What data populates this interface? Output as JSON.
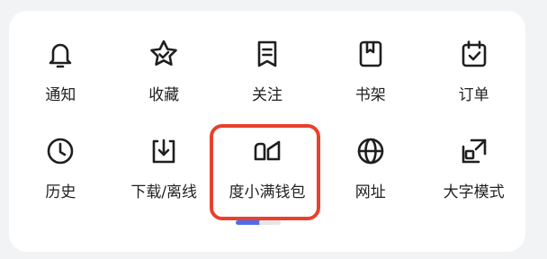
{
  "colors": {
    "highlight": "#e8412c",
    "pager_active": "#4d6cf0"
  },
  "grid": {
    "row1": [
      {
        "label": "通知",
        "icon": "bell-icon"
      },
      {
        "label": "收藏",
        "icon": "star-icon"
      },
      {
        "label": "关注",
        "icon": "bookmark-note-icon"
      },
      {
        "label": "书架",
        "icon": "book-icon"
      },
      {
        "label": "订单",
        "icon": "calendar-check-icon"
      }
    ],
    "row2": [
      {
        "label": "历史",
        "icon": "clock-icon"
      },
      {
        "label": "下载/离线",
        "icon": "download-icon"
      },
      {
        "label": "度小满钱包",
        "icon": "wallet-logo-icon"
      },
      {
        "label": "网址",
        "icon": "globe-icon"
      },
      {
        "label": "大字模式",
        "icon": "resize-icon"
      }
    ]
  }
}
